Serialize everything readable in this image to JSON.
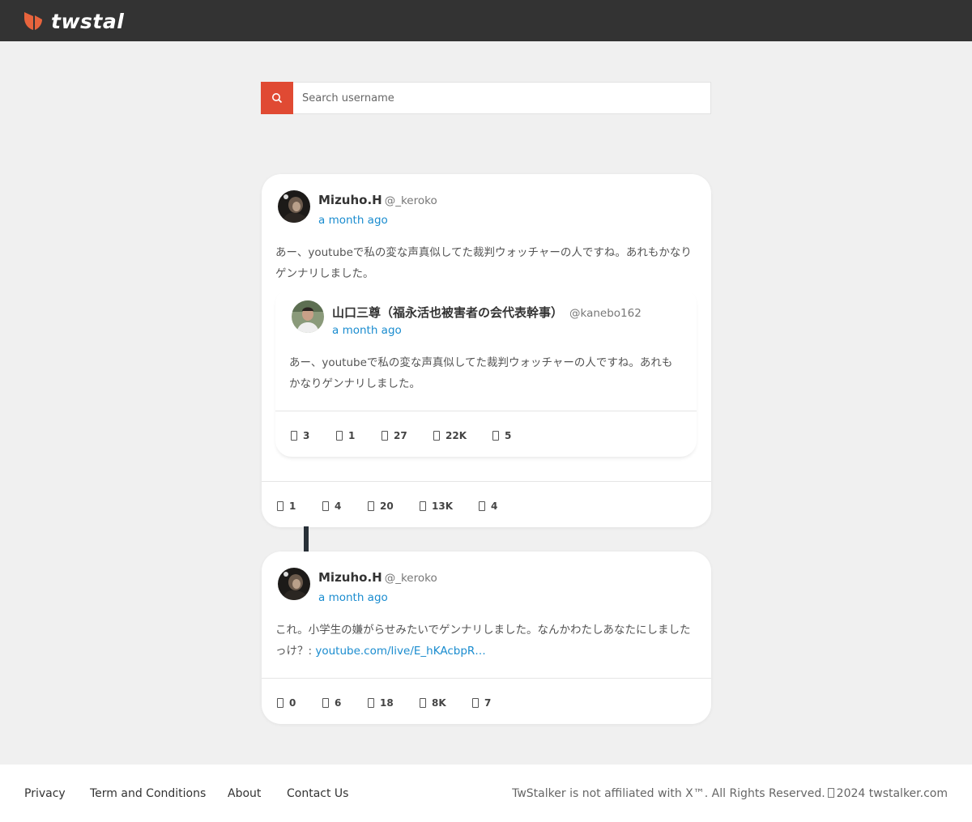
{
  "brand": {
    "name": "twstalker",
    "logo_icon": "twstalker-logo-icon",
    "accent": "#e04a33"
  },
  "search": {
    "placeholder": "Search username",
    "icon": "search-icon"
  },
  "posts": [
    {
      "author": {
        "name": "Mizuho.H",
        "handle": "@_keroko"
      },
      "time": "a month ago",
      "text": "あー、youtubeで私の変な声真似してた裁判ウォッチャーの人ですね。あれもかなりゲンナリしました。",
      "quoted": {
        "author": {
          "name": "山口三尊（福永活也被害者の会代表幹事）",
          "handle": "@kanebo162"
        },
        "time": "a month ago",
        "text": "あー、youtubeで私の変な声真似してた裁判ウォッチャーの人ですね。あれもかなりゲンナリしました。",
        "stats": {
          "replies": "3",
          "retweets": "1",
          "likes": "27",
          "views": "22K",
          "bookmarks": "5"
        }
      },
      "stats": {
        "replies": "1",
        "retweets": "4",
        "likes": "20",
        "views": "13K",
        "bookmarks": "4"
      }
    },
    {
      "author": {
        "name": "Mizuho.H",
        "handle": "@_keroko"
      },
      "time": "a month ago",
      "text": "これ。小学生の嫌がらせみたいでゲンナリしました。なんかわたしあなたにしましたっけ？: ",
      "link": "youtube.com/live/E_hKAcbpR…",
      "stats": {
        "replies": "0",
        "retweets": "6",
        "likes": "18",
        "views": "8K",
        "bookmarks": "7"
      }
    }
  ],
  "footer": {
    "links": [
      "Privacy",
      "Term and Conditions",
      "About",
      "Contact Us"
    ],
    "copyright_before": "TwStalker is not affiliated with X™. All Rights Reserved.",
    "copyright_after": "2024 twstalker.com"
  }
}
